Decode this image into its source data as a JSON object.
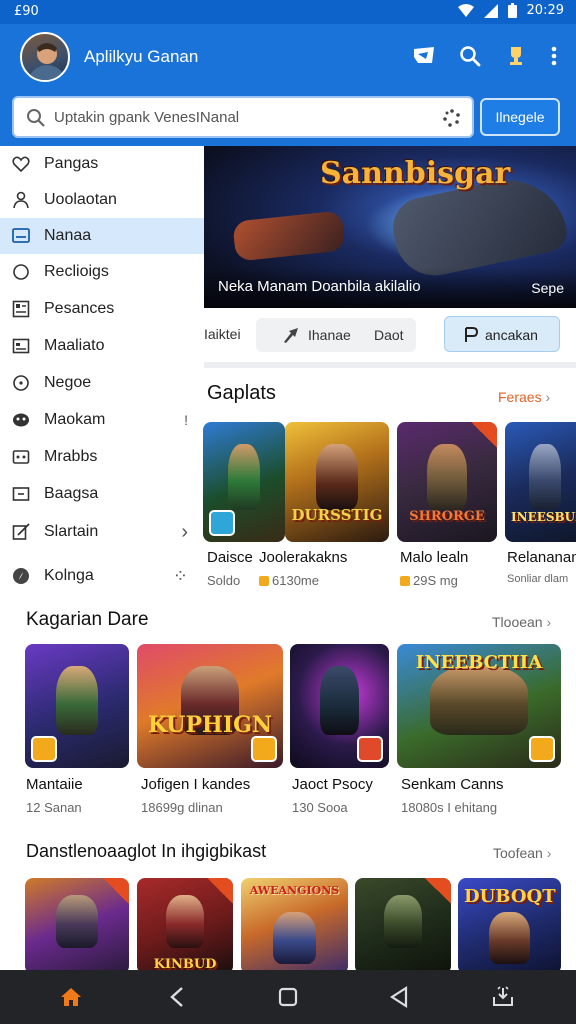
{
  "status_bar": {
    "time": "£90",
    "clock": "20:29"
  },
  "app_bar": {
    "title": "Aplilkyu Ganan"
  },
  "search": {
    "placeholder": "Uptakin gpank VenesINanal",
    "button_label": "Ilnegele"
  },
  "drawer": {
    "items": [
      {
        "label": "Pangas",
        "icon": "heart-icon",
        "trailing": ""
      },
      {
        "label": "Uoolaotan",
        "icon": "person-icon",
        "trailing": ""
      },
      {
        "label": "Nanaa",
        "icon": "screen-icon",
        "trailing": "",
        "active": true
      },
      {
        "label": "Reclioigs",
        "icon": "circle-icon",
        "trailing": ""
      },
      {
        "label": "Pesances",
        "icon": "grid-icon",
        "trailing": ""
      },
      {
        "label": "Maaliato",
        "icon": "card-icon",
        "trailing": ""
      },
      {
        "label": "Negoe",
        "icon": "clock-icon",
        "trailing": ""
      },
      {
        "label": "Maokam",
        "icon": "gamepad-icon",
        "trailing": "!"
      },
      {
        "label": "Mrabbs",
        "icon": "dots-icon",
        "trailing": ""
      },
      {
        "label": "Baagsa",
        "icon": "box-icon",
        "trailing": ""
      },
      {
        "label": "Slartain",
        "icon": "edit-icon",
        "trailing": "›"
      },
      {
        "label": "Kolnga",
        "icon": "compass-icon",
        "trailing": "⁘"
      }
    ]
  },
  "hero": {
    "title": "Sannbisgar",
    "caption": "Neka Manam Doanbila akilalio",
    "caption_right": "Sepe"
  },
  "filters": {
    "chip0": "Iaiktei",
    "chip1_a": "Ihanae",
    "chip1_b": "Daot",
    "chip2": "ancakan"
  },
  "section1": {
    "title": "Gaplats",
    "more": "Feraes",
    "cards": [
      {
        "name": "Daisce",
        "sub": "Soldo"
      },
      {
        "name": "Joolerakakns",
        "sub": "6130me",
        "logo": "DURSSTIG"
      },
      {
        "name": "Malo lealn",
        "sub": "29S mg",
        "logo": "SHRORGE"
      },
      {
        "name": "Relananan",
        "sub": "Sonliar dlam",
        "logo": "INEESBUB"
      }
    ]
  },
  "section2": {
    "title": "Kagarian Dare",
    "more": "Tlooean",
    "cards": [
      {
        "name": "Mantaiie",
        "sub": "12 Sanan"
      },
      {
        "name": "Jofigen I kandes",
        "sub": "18699g dlinan",
        "logo": "KUPHIGN"
      },
      {
        "name": "Jaoct Psocy",
        "sub": "130 Sooa"
      },
      {
        "name": "Senkam Canns",
        "sub": "18080s I ehitang",
        "logo": "INEEBCTIIA"
      }
    ]
  },
  "section3": {
    "title": "Danstlenoaaglot In ihgigbikast",
    "more": "Toofean",
    "cards": [
      {
        "logo": ""
      },
      {
        "logo": "KINBUD"
      },
      {
        "logo": "AWEANGIONS"
      },
      {
        "logo": ""
      },
      {
        "logo": "DUBOQT"
      }
    ]
  },
  "colors": {
    "primary": "#1a73d9",
    "accent": "#e0622c",
    "nav_bg": "#222427"
  }
}
